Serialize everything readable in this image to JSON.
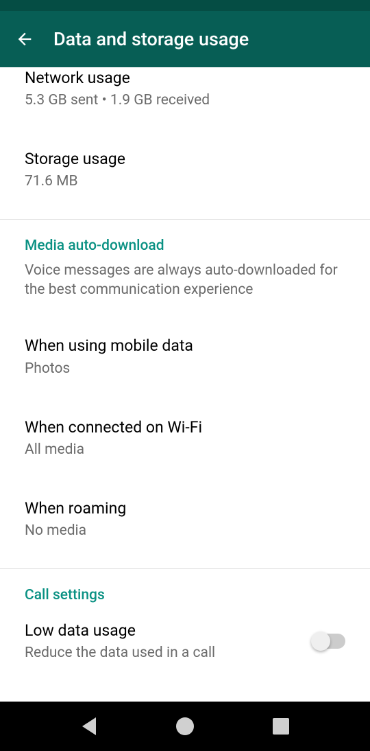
{
  "header": {
    "title": "Data and storage usage"
  },
  "usage": {
    "network": {
      "title": "Network usage",
      "subtitle": "5.3 GB sent • 1.9 GB received"
    },
    "storage": {
      "title": "Storage usage",
      "subtitle": "71.6 MB"
    }
  },
  "media": {
    "header": "Media auto-download",
    "description": "Voice messages are always auto-downloaded for the best communication experience",
    "mobile": {
      "title": "When using mobile data",
      "subtitle": "Photos"
    },
    "wifi": {
      "title": "When connected on Wi-Fi",
      "subtitle": "All media"
    },
    "roaming": {
      "title": "When roaming",
      "subtitle": "No media"
    }
  },
  "call": {
    "header": "Call settings",
    "lowdata": {
      "title": "Low data usage",
      "subtitle": "Reduce the data used in a call"
    }
  }
}
